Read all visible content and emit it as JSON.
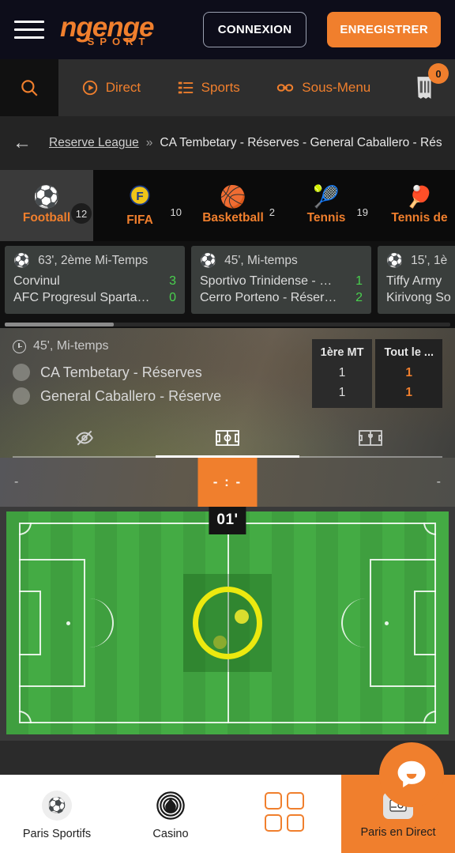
{
  "header": {
    "menu_label": "menu",
    "logo_main": "ngenge",
    "logo_sub": "SPORT",
    "login_label": "CONNEXION",
    "register_label": "ENREGISTRER"
  },
  "nav": {
    "search_icon": "search-icon",
    "items": [
      {
        "label": "Direct",
        "icon": "play-circle-icon"
      },
      {
        "label": "Sports",
        "icon": "list-icon"
      },
      {
        "label": "Sous-Menu",
        "icon": "link-icon"
      }
    ],
    "betslip_icon": "betslip-icon",
    "betslip_count": "0"
  },
  "breadcrumb": {
    "back_icon": "arrow-left-icon",
    "league": "Reserve League",
    "separator": "»",
    "current": "CA Tembetary - Réserves - General Caballero - Réserves"
  },
  "sports": [
    {
      "label": "Football",
      "count": "12",
      "icon": "⚽",
      "active": true
    },
    {
      "label": "FIFA",
      "count": "10",
      "icon": "🅕",
      "active": false
    },
    {
      "label": "Basketball",
      "count": "2",
      "icon": "🏀",
      "active": false
    },
    {
      "label": "Tennis",
      "count": "19",
      "icon": "🎾",
      "active": false
    },
    {
      "label": "Tennis de",
      "count": "",
      "icon": "🏓",
      "active": false
    }
  ],
  "match_cards": [
    {
      "icon": "⚽",
      "time": "63', 2ème Mi-Temps",
      "home": "Corvinul",
      "home_score": "3",
      "away": "AFC Progresul Spartac...",
      "away_score": "0"
    },
    {
      "icon": "⚽",
      "time": "45', Mi-temps",
      "home": "Sportivo Trinidense - R...",
      "home_score": "1",
      "away": "Cerro Porteno - Réserv...",
      "away_score": "2"
    },
    {
      "icon": "⚽",
      "time": "15', 1è",
      "home": "Tiffy Army",
      "home_score": "",
      "away": "Kirivong So",
      "away_score": ""
    }
  ],
  "detail": {
    "clock_icon": "clock-icon",
    "time": "45', Mi-temps",
    "home_team": "CA Tembetary - Réserves",
    "away_team": "General Caballero - Réserve",
    "score_columns": [
      {
        "header": "1ère MT",
        "home": "1",
        "away": "1",
        "current": false
      },
      {
        "header": "Tout le ...",
        "home": "1",
        "away": "1",
        "current": true
      }
    ]
  },
  "view_tabs": [
    {
      "icon": "eye-off-icon",
      "active": false
    },
    {
      "icon": "pitch-icon",
      "active": true
    },
    {
      "icon": "stats-icon",
      "active": false
    }
  ],
  "live_bar": {
    "left": "-",
    "center": "- : -",
    "right": "-"
  },
  "pitch": {
    "minute_badge": "01'"
  },
  "bottom_nav": [
    {
      "label": "Paris Sportifs",
      "icon": "soccer-ball-icon",
      "active": false
    },
    {
      "label": "Casino",
      "icon": "casino-chip-icon",
      "active": false
    },
    {
      "label": "",
      "icon": "grid-icon",
      "active": false
    },
    {
      "label": "Paris en Direct",
      "icon": "live-betting-icon",
      "active": true
    }
  ],
  "fab": {
    "icon": "chat-icon"
  },
  "colors": {
    "accent": "#f07f2d",
    "header_bg": "#0d0d1a",
    "nav_bg": "#2e2e2e",
    "score_green": "#49d14e",
    "pitch_green": "#3fa03f",
    "highlight_yellow": "#ece90f"
  }
}
